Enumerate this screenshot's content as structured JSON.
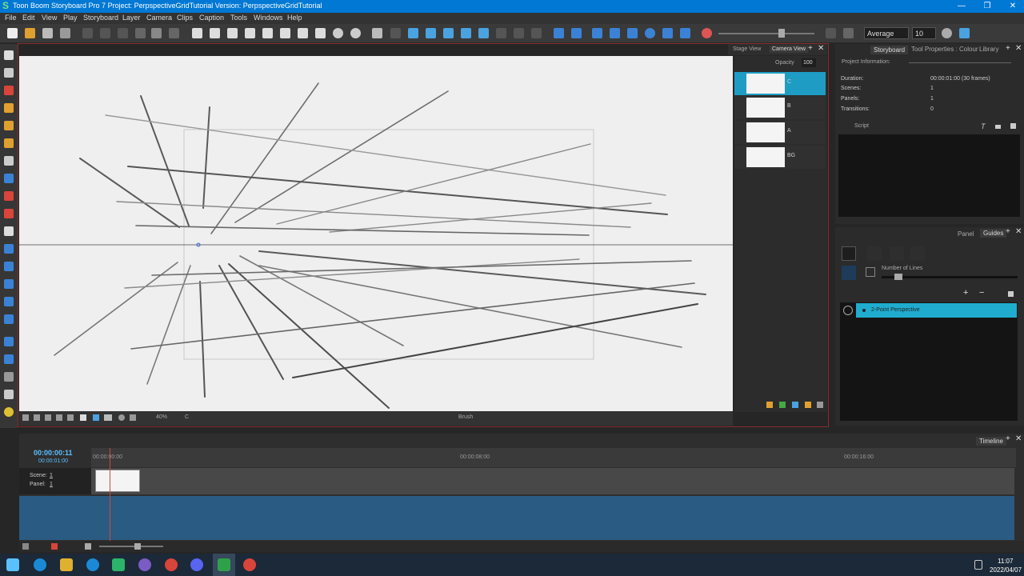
{
  "window": {
    "title": "Toon Boom Storyboard Pro 7 Project: PerpspectiveGridTutorial Version: PerpspectiveGridTutorial",
    "app_icon": "S"
  },
  "menu": [
    "File",
    "Edit",
    "View",
    "Play",
    "Storyboard",
    "Layer",
    "Camera",
    "Clips",
    "Caption",
    "Tools",
    "Windows",
    "Help"
  ],
  "toolbar": {
    "brush_mode": "Average",
    "brush_size": "10"
  },
  "stage": {
    "tabs": [
      "Stage View",
      "Camera View"
    ],
    "zoom": "40%",
    "layer_indicator": "C",
    "tool_name": "Brush"
  },
  "layers": {
    "opacity_label": "Opacity",
    "opacity_value": "100",
    "items": [
      {
        "name": "C"
      },
      {
        "name": "B"
      },
      {
        "name": "A"
      },
      {
        "name": "BG"
      }
    ]
  },
  "storyboard_panel": {
    "tabs": [
      "Storyboard",
      "Tool Properties : Colour",
      "Library"
    ],
    "section": "Project Information:",
    "duration_label": "Duration:",
    "duration_value": "00:00:01:00  (30 frames)",
    "scenes_label": "Scenes:",
    "scenes_value": "1",
    "panels_label": "Panels:",
    "panels_value": "1",
    "transitions_label": "Transitions:",
    "transitions_value": "0",
    "script_label": "Script"
  },
  "guides_panel": {
    "tabs": [
      "Panel",
      "Guides"
    ],
    "number_of_lines_label": "Number of Lines",
    "guide_item": "2-Point Perspective"
  },
  "timeline": {
    "tab": "Timeline",
    "current_time": "00:00:00:11",
    "total_time": "00:00:01:00",
    "ruler": [
      "00:00:00:00",
      "00:00:08:00",
      "00:00:16:00"
    ],
    "scene_label": "Scene:",
    "scene_value": "1",
    "panel_label": "Panel:",
    "panel_value": "1"
  },
  "taskbar": {
    "time": "11:07",
    "date": "2022/04/07"
  },
  "colors": {
    "accent": "#1f9cc4",
    "titlebar": "#0078d4",
    "frame": "#8a2b2b"
  }
}
